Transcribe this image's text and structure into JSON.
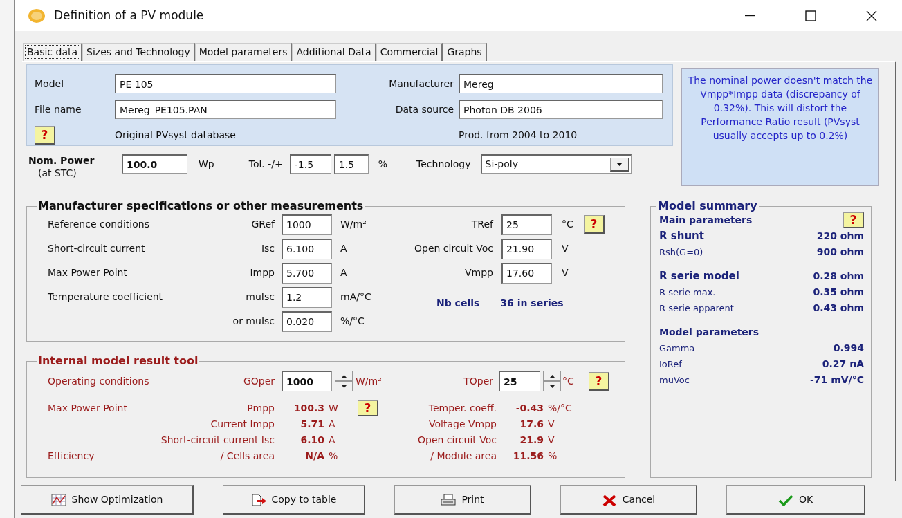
{
  "window": {
    "title": "Definition of a PV module"
  },
  "tabs": [
    {
      "label": "Basic data",
      "selected": true
    },
    {
      "label": "Sizes and Technology",
      "selected": false
    },
    {
      "label": "Model parameters",
      "selected": false
    },
    {
      "label": "Additional Data",
      "selected": false
    },
    {
      "label": "Commercial",
      "selected": false
    },
    {
      "label": "Graphs",
      "selected": false
    }
  ],
  "identity": {
    "fields": [
      {
        "label": "Model",
        "value": "PE 105"
      },
      {
        "label": "Manufacturer",
        "value": "Mereg"
      },
      {
        "label": "File name",
        "value": "Mereg_PE105.PAN"
      },
      {
        "label": "Data source",
        "value": "Photon DB 2006"
      }
    ],
    "help": "?",
    "origin": "Original PVsyst database",
    "production": "Prod. from 2004 to 2010"
  },
  "warning": "The nominal power doesn't match the Vmpp*Impp data (discrepancy of 0.32%). This will distort the Performance Ratio result (PVsyst usually accepts up to 0.2%)",
  "nominal": {
    "label": "Nom. Power",
    "sublabel": "(at STC)",
    "value": "100.0",
    "unit": "Wp",
    "tolerance_label": "Tol. -/+",
    "tolerance_minus": "-1.5",
    "tolerance_plus": "1.5",
    "tolerance_unit": "%",
    "technology_label": "Technology",
    "technology": "Si-poly"
  },
  "specs": {
    "title": "Manufacturer specifications or other measurements",
    "help": "?",
    "rows": [
      {
        "label": "Reference conditions",
        "quantity": "GRef",
        "value": "1000",
        "unit": "W/m²",
        "right_quantity": "TRef",
        "right_value": "25",
        "right_unit": "°C"
      },
      {
        "label": "Short-circuit current",
        "quantity": "Isc",
        "value": "6.100",
        "unit": "A",
        "right_quantity": "Open circuit Voc",
        "right_value": "21.90",
        "right_unit": "V"
      },
      {
        "label": "Max Power Point",
        "quantity": "Impp",
        "value": "5.700",
        "unit": "A",
        "right_quantity": "Vmpp",
        "right_value": "17.60",
        "right_unit": "V"
      },
      {
        "label": "Temperature coefficient",
        "quantity": "muIsc",
        "value": "1.2",
        "unit": "mA/°C"
      },
      {
        "quantity": "or muIsc",
        "value": "0.020",
        "unit": "%/°C"
      }
    ],
    "cells": {
      "label": "Nb cells",
      "value": "36 in series"
    }
  },
  "tool": {
    "title": "Internal model result tool",
    "help": "?",
    "operating": {
      "label": "Operating conditions",
      "quantity": "GOper",
      "value": "1000",
      "unit": "W/m²",
      "right_quantity": "TOper",
      "right_value": "25",
      "right_unit": "°C"
    },
    "rows": [
      {
        "label": "Max Power Point",
        "quantity": "Pmpp",
        "value": "100.3",
        "unit": "W",
        "help": "?",
        "right_quantity": "Temper. coeff.",
        "right_value": "-0.43",
        "right_unit": "%/°C"
      },
      {
        "quantity": "Current Impp",
        "value": "5.71",
        "unit": "A",
        "right_quantity": "Voltage Vmpp",
        "right_value": "17.6",
        "right_unit": "V"
      },
      {
        "quantity": "Short-circuit current Isc",
        "value": "6.10",
        "unit": "A",
        "right_quantity": "Open circuit Voc",
        "right_value": "21.9",
        "right_unit": "V"
      },
      {
        "label": "Efficiency",
        "quantity": "/ Cells area",
        "value": "N/A",
        "unit": "%",
        "right_quantity": "/ Module area",
        "right_value": "11.56",
        "right_unit": "%"
      }
    ]
  },
  "summary": {
    "title": "Model summary",
    "groups": [
      {
        "heading": "Main parameters",
        "help": "?",
        "items": [
          {
            "label": "R shunt",
            "value": "220 ohm",
            "emphasis": true
          },
          {
            "label": "Rsh(G=0)",
            "value": "900 ohm",
            "emphasis": false
          }
        ]
      },
      {
        "items": [
          {
            "label": "R serie model",
            "value": "0.28 ohm",
            "emphasis": true
          },
          {
            "label": "R serie max.",
            "value": "0.35 ohm",
            "emphasis": false
          },
          {
            "label": "R serie apparent",
            "value": "0.43 ohm",
            "emphasis": false
          }
        ]
      },
      {
        "heading": "Model parameters",
        "items": [
          {
            "label": "Gamma",
            "value": "0.994",
            "emphasis": false
          },
          {
            "label": "IoRef",
            "value": "0.27 nA",
            "emphasis": false
          },
          {
            "label": "muVoc",
            "value": "-71 mV/°C",
            "emphasis": false
          }
        ]
      }
    ]
  },
  "buttons": [
    {
      "label": "Show Optimization",
      "kind": "chart"
    },
    {
      "label": "Copy to table",
      "kind": "copy"
    },
    {
      "label": "Print",
      "kind": "print"
    },
    {
      "label": "Cancel",
      "kind": "cancel"
    },
    {
      "label": "OK",
      "kind": "ok"
    }
  ]
}
